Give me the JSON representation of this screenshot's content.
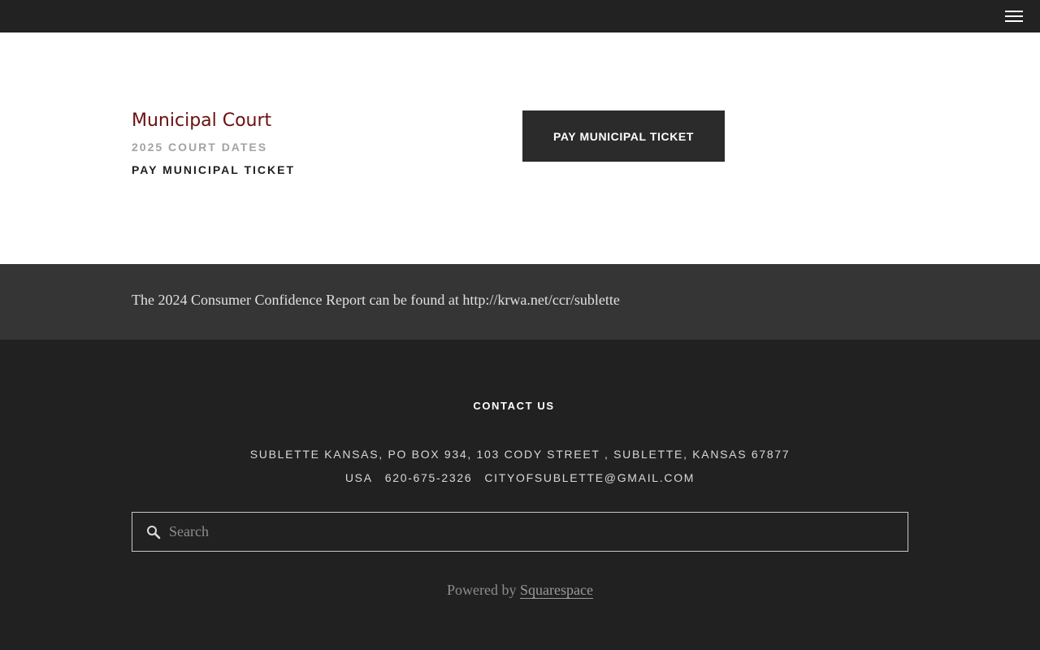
{
  "topbar": {
    "menu_icon": "hamburger-menu-icon"
  },
  "court": {
    "title": "Municipal Court",
    "links": {
      "court_dates": "2025 COURT DATES",
      "pay_ticket": "PAY MUNICIPAL TICKET"
    },
    "button_label": "PAY MUNICIPAL TICKET"
  },
  "announcement": {
    "text": "The 2024 Consumer Confidence Report can be found at http://krwa.net/ccr/sublette"
  },
  "footer": {
    "contact_heading": "CONTACT US",
    "address": "SUBLETTE KANSAS, PO BOX 934, 103 CODY STREET , SUBLETTE, KANSAS 67877",
    "country": "USA",
    "phone": "620-675-2326",
    "email": "CITYOFSUBLETTE@GMAIL.COM",
    "search": {
      "placeholder": "Search",
      "icon": "search-icon"
    },
    "powered_prefix": "Powered by",
    "powered_link": "Squarespace"
  },
  "colors": {
    "topbar_bg": "#222222",
    "court_title": "#6b1010",
    "button_bg": "#2b2b2b",
    "announcement_bg": "#353535",
    "footer_bg": "#212121"
  }
}
